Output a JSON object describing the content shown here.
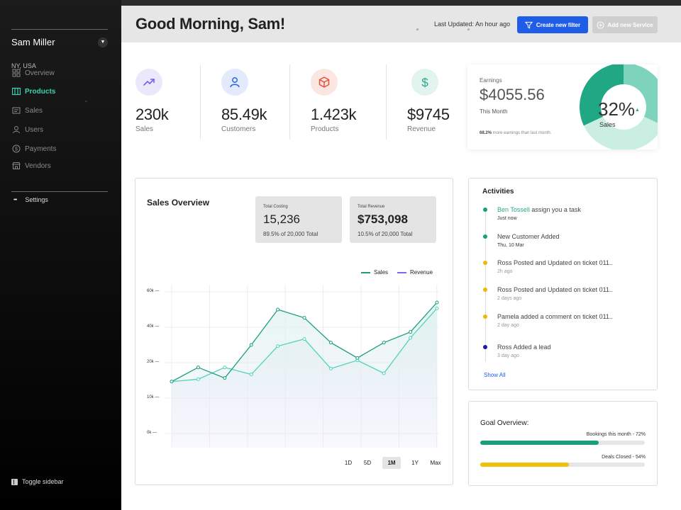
{
  "sidebar": {
    "user_name": "Sam Miller",
    "location": "NY, USA",
    "items": [
      {
        "label": "Overview",
        "icon": "grid-icon"
      },
      {
        "label": "Products",
        "icon": "columns-icon"
      },
      {
        "label": "Sales",
        "icon": "sales-icon"
      },
      {
        "label": "Users",
        "icon": "user-icon"
      },
      {
        "label": "Payments",
        "icon": "dollar-circle-icon"
      },
      {
        "label": "Vendors",
        "icon": "store-icon"
      }
    ],
    "active_item": "Products",
    "settings_label": "Settings",
    "settings_icon_text": "•••",
    "toggle_label": "Toggle sidebar"
  },
  "header": {
    "greeting": "Good Morning, Sam!",
    "last_updated": "Last Updated: An hour ago",
    "create_filter_label": "Create new filter",
    "add_service_label": "Add new Service"
  },
  "stats": [
    {
      "value": "230k",
      "label": "Sales",
      "icon": "trend-up-icon",
      "color": "#7a5cf0",
      "bg": "#ece8fb"
    },
    {
      "value": "85.49k",
      "label": "Customers",
      "icon": "user-icon",
      "color": "#2a63e4",
      "bg": "#e2eafb"
    },
    {
      "value": "1.423k",
      "label": "Products",
      "icon": "box-icon",
      "color": "#e0523a",
      "bg": "#fbe6e1"
    },
    {
      "value": "$9745",
      "label": "Revenue",
      "icon": "dollar-icon",
      "color": "#2aa68a",
      "bg": "#e2f4ee"
    }
  ],
  "earnings": {
    "title": "Earnings",
    "value": "$4055.56",
    "period": "This Month",
    "footnote_bold": "68.2%",
    "footnote_rest": " more earnings than last month.",
    "percent": "32%",
    "percent_label": "Sales",
    "trend_arrow": "▲",
    "share": 0.32
  },
  "sales_overview": {
    "title": "Sales Overview",
    "total_costing": {
      "label": "Total Costing",
      "value": "15,236",
      "percent": "89.5%",
      "note": " of 20,000 Total"
    },
    "total_revenue": {
      "label": "Total Revenue",
      "value": "$753,098",
      "percent": "10.5%",
      "note": " of 20,000 Total"
    },
    "ranges": [
      "1D",
      "5D",
      "1M",
      "1Y",
      "Max"
    ],
    "active_range": "1M"
  },
  "chart_data": {
    "type": "line",
    "x": [
      1,
      2,
      3,
      4,
      5,
      6,
      7,
      8,
      9,
      10,
      11
    ],
    "yticks": [
      "60k",
      "40k",
      "20k",
      "10k",
      "0k"
    ],
    "ylim": [
      0,
      60000
    ],
    "legend_position": "top-right",
    "grid": true,
    "series": [
      {
        "name": "Sales",
        "color": "#1a9e7c",
        "values": [
          22000,
          28000,
          23500,
          37500,
          52500,
          49000,
          38500,
          32000,
          38500,
          43000,
          55500
        ]
      },
      {
        "name": "Revenue",
        "color": "#7b68ee",
        "values": [
          22000,
          23000,
          28000,
          25000,
          37000,
          40000,
          27500,
          31000,
          25500,
          40500,
          53000
        ]
      }
    ]
  },
  "activities": {
    "title": "Activities",
    "items": [
      {
        "highlight": "Ben Tossell",
        "text": " assign you a task",
        "time": "Just now",
        "color": "#1a9e7c",
        "time_dark": true
      },
      {
        "highlight": "",
        "text": "New Customer Added",
        "time": "Thu, 10 Mar",
        "color": "#1a9e7c",
        "time_dark": true
      },
      {
        "highlight": "",
        "text": "Ross Posted and Updated on ticket 011..",
        "time": "2h ago",
        "color": "#f2b705",
        "time_dark": false
      },
      {
        "highlight": "",
        "text": "Ross Posted and Updated on ticket 011..",
        "time": "2 days ago",
        "color": "#f2b705",
        "time_dark": false
      },
      {
        "highlight": "",
        "text": "Pamela added a comment on ticket 011..",
        "time": "2 day ago",
        "color": "#f2b705",
        "time_dark": false
      },
      {
        "highlight": "",
        "text": "Ross Added a lead",
        "time": "3 day ago",
        "color": "#1a1ab0",
        "time_dark": false
      }
    ],
    "show_all": "Show All"
  },
  "goal_overview": {
    "title": "Goal Overview:",
    "goals": [
      {
        "label": "Bookings this month - 72%",
        "fraction": 0.72,
        "color": "#1a9e7c"
      },
      {
        "label": "Deals Closed  - 54%",
        "fraction": 0.54,
        "color": "#f2c00c"
      }
    ]
  }
}
